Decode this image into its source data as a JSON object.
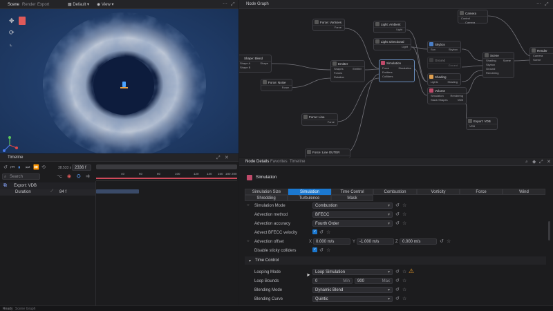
{
  "top_bar": {
    "scene_tab": "Scene",
    "render_tab": "Render",
    "export_tab": "Export",
    "shading_dropdown": "Default",
    "view_dropdown": "View"
  },
  "node_graph": {
    "title": "Node Graph",
    "nodes": [
      {
        "title": "Camera",
        "rows": [
          "Control",
          "Camera"
        ]
      },
      {
        "title": "Force: Vorticies",
        "rows": [
          "Force"
        ]
      },
      {
        "title": "Light: Ambient",
        "rows": [
          "Light"
        ]
      },
      {
        "title": "Light: Directional",
        "rows": [
          "Light"
        ]
      },
      {
        "title": "Skybox",
        "rows": [
          "Sun",
          "Skybox"
        ]
      },
      {
        "title": "Shape: Blend",
        "rows": [
          "Shape A",
          "Shape B"
        ],
        "extra": "Shape"
      },
      {
        "title": "Emitter",
        "rows": [
          "Shapes",
          "Forces",
          "Rotation"
        ],
        "extra": "Emitter"
      },
      {
        "title": "Simulation",
        "rows": [
          "Force",
          "Emitters",
          "Colliders"
        ],
        "extra": "Simulation"
      },
      {
        "title": "Force: Noise",
        "rows": [
          "Force"
        ]
      },
      {
        "title": "Ground",
        "rows": [
          "Ground"
        ]
      },
      {
        "title": "Shading",
        "rows": [
          "Lights",
          "Shading"
        ]
      },
      {
        "title": "Volume",
        "rows": [
          "Simulation",
          "Stack Shapes"
        ],
        "extra": [
          "Rendering",
          "VDB"
        ]
      },
      {
        "title": "Scene",
        "rows": [
          "Shading",
          "Skybox",
          "Ground",
          "Rendering"
        ],
        "extra": "Scene"
      },
      {
        "title": "Render",
        "rows": [
          "Camera",
          "Scene"
        ]
      },
      {
        "title": "Export: VDB",
        "rows": [
          "VDB"
        ]
      },
      {
        "title": "Force: Line",
        "rows": [
          "Force"
        ]
      },
      {
        "title": "Force: Line OUTER REVERSED",
        "rows": []
      }
    ]
  },
  "timeline": {
    "title": "Timeline",
    "frame_time": "38.533 s",
    "frame_number": "2336 f",
    "search_placeholder": "Search",
    "track_export": "Export: VDB",
    "track_duration": "Duration",
    "duration_value": "84 f",
    "ruler_ticks": [
      "40",
      "60",
      "80",
      "100",
      "120",
      "140",
      "160",
      "180",
      "200"
    ]
  },
  "details": {
    "tabs": [
      "Node Details",
      "Favorites",
      "Timeline"
    ],
    "node_name": "Simulation",
    "section_tabs_row1": [
      "Simulation Size",
      "Simulation",
      "Time Control",
      "Combustion",
      "Vorticity",
      "Force",
      "Wind"
    ],
    "section_tabs_row2": [
      "Shredding",
      "Turbulence",
      "Mask"
    ],
    "properties": [
      {
        "label": "Simulation Mode",
        "value": "Combustion"
      },
      {
        "label": "Advection method",
        "value": "BFECC"
      },
      {
        "label": "Advection accuracy",
        "value": "Fourth Order"
      },
      {
        "label": "Advect BFECC velocity",
        "value": ""
      },
      {
        "label": "Advection offset",
        "x": "0.000 m/s",
        "y": "-1.000 m/s",
        "z": "0.000 m/s"
      },
      {
        "label": "Disable sticky colliders",
        "value": ""
      }
    ],
    "group_title": "Time Control",
    "time_props": [
      {
        "label": "Looping Mode",
        "value": "Loop Simulation"
      },
      {
        "label": "Loop Bounds",
        "min": "0",
        "min_label": "Min",
        "max": "900",
        "max_label": "Max"
      },
      {
        "label": "Blending Mode",
        "value": "Dynamic Blend"
      },
      {
        "label": "Blending Curve",
        "value": "Quintic"
      }
    ]
  },
  "status_bar": {
    "text": "Ready",
    "sub": "Scene Graph"
  },
  "colors": {
    "accent": "#1b78d0",
    "warning": "#e89a2a",
    "bg": "#1b1b1d"
  }
}
